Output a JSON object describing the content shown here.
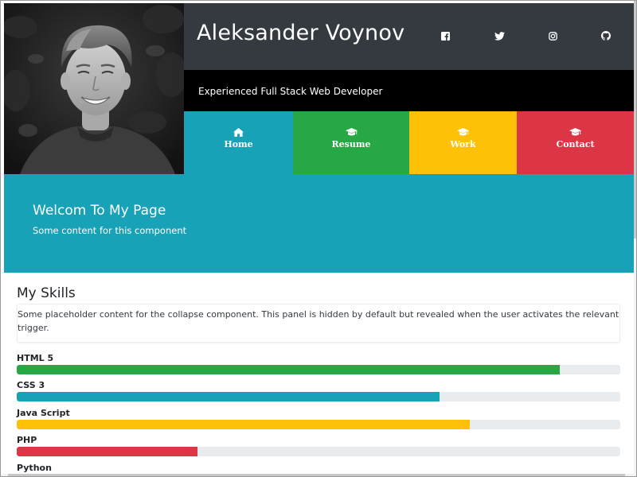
{
  "profile": {
    "name": "Aleksander Voynov",
    "tagline": "Experienced Full Stack Web Developer",
    "photo_alt": "portrait-photo"
  },
  "social": [
    {
      "name": "facebook",
      "icon": "facebook-icon"
    },
    {
      "name": "twitter",
      "icon": "twitter-icon"
    },
    {
      "name": "instagram",
      "icon": "instagram-icon"
    },
    {
      "name": "github",
      "icon": "github-icon"
    }
  ],
  "nav": [
    {
      "label": "Home",
      "icon": "home-icon",
      "color": "#17a2b8"
    },
    {
      "label": "Resume",
      "icon": "graduation-cap-icon",
      "color": "#28a745"
    },
    {
      "label": "Work",
      "icon": "graduation-cap-icon",
      "color": "#ffc107"
    },
    {
      "label": "Contact",
      "icon": "graduation-cap-icon",
      "color": "#dc3545"
    }
  ],
  "hero": {
    "title": "Welcom To My Page",
    "text": "Some content for this component",
    "color": "#17a2b8"
  },
  "skills": {
    "title": "My Skills",
    "collapse_text": "Some placeholder content for the collapse component. This panel is hidden by default but revealed when the user activates the relevant trigger.",
    "items": [
      {
        "label": "HTML 5",
        "percent": 90,
        "color": "#28a745"
      },
      {
        "label": "CSS 3",
        "percent": 70,
        "color": "#17a2b8"
      },
      {
        "label": "Java Script",
        "percent": 75,
        "color": "#ffc107"
      },
      {
        "label": "PHP",
        "percent": 30,
        "color": "#dc3545"
      },
      {
        "label": "Python",
        "percent": null,
        "color": null
      }
    ]
  }
}
